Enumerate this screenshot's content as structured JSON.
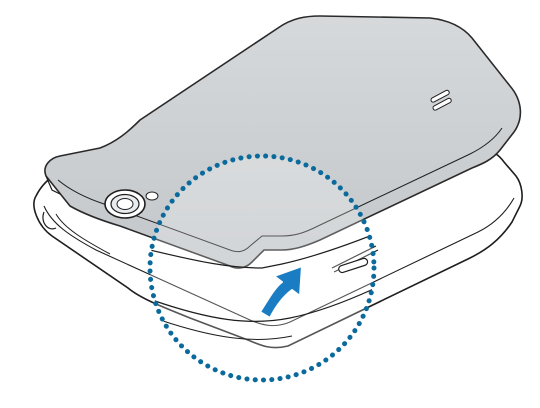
{
  "illustration": {
    "subject": "phone-back-cover-removal",
    "icons": [
      "phone-body-icon",
      "back-cover-icon",
      "camera-lens-icon",
      "speaker-grille-icon",
      "magnifier-circle-icon",
      "lift-arrow-icon"
    ],
    "colors": {
      "background": "#ffffff",
      "cover_fill": "#cfd3d6",
      "cover_outline": "#2a2a2a",
      "body_fill": "#ffffff",
      "line": "#1e1e1e",
      "callout_dots": "#0b6a9c",
      "arrow_fill": "#1a7cc2"
    }
  }
}
